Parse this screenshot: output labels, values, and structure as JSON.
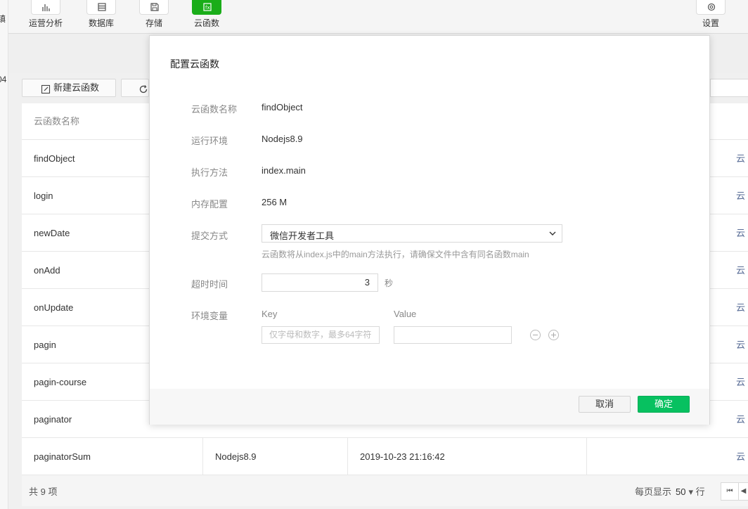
{
  "left_fragments": [
    "镇",
    "04"
  ],
  "toolbar": {
    "items": [
      {
        "label": "运营分析",
        "icon": "bar-chart-icon",
        "active": false
      },
      {
        "label": "数据库",
        "icon": "database-icon",
        "active": false
      },
      {
        "label": "存储",
        "icon": "save-icon",
        "active": false
      },
      {
        "label": "云函数",
        "icon": "cloud-function-icon",
        "active": true
      }
    ],
    "settings_label": "设置"
  },
  "actions": {
    "new_function": "新建云函数"
  },
  "table": {
    "header": "云函数名称",
    "rows": [
      {
        "name": "findObject",
        "right": "云"
      },
      {
        "name": "login",
        "right": "云"
      },
      {
        "name": "newDate",
        "right": "云"
      },
      {
        "name": "onAdd",
        "right": "云"
      },
      {
        "name": "onUpdate",
        "right": "云"
      },
      {
        "name": "pagin",
        "right": "云"
      },
      {
        "name": "pagin-course",
        "right": "云"
      },
      {
        "name": "paginator",
        "right": "云"
      },
      {
        "name": "paginatorSum",
        "runtime": "Nodejs8.9",
        "time": "2019-10-23 21:16:42",
        "right": "云"
      }
    ]
  },
  "footer": {
    "total": "共 9 项",
    "per_page_prefix": "每页显示",
    "per_page_value": "50",
    "per_page_suffix": "行"
  },
  "modal": {
    "title": "配置云函数",
    "fields": {
      "name_label": "云函数名称",
      "name_value": "findObject",
      "runtime_label": "运行环境",
      "runtime_value": "Nodejs8.9",
      "handler_label": "执行方法",
      "handler_value": "index.main",
      "memory_label": "内存配置",
      "memory_value": "256 M",
      "submit_label": "提交方式",
      "submit_value": "微信开发者工具",
      "submit_hint": "云函数将从index.js中的main方法执行，请确保文件中含有同名函数main",
      "timeout_label": "超时时间",
      "timeout_value": "3",
      "timeout_unit": "秒",
      "env_label": "环境变量",
      "env_key_header": "Key",
      "env_value_header": "Value",
      "env_key_placeholder": "仅字母和数字，最多64字符"
    },
    "cancel_label": "取消",
    "ok_label": "确定"
  },
  "colors": {
    "primary": "#07c160",
    "active_tool": "#1aad19",
    "link": "#576b95"
  }
}
